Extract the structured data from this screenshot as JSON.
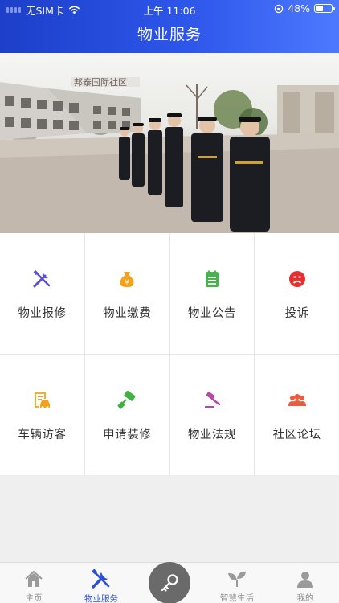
{
  "status_bar": {
    "carrier": "无SIM卡",
    "time": "上午 11:06",
    "battery_text": "48%",
    "battery_level": 0.48
  },
  "header": {
    "title": "物业服务"
  },
  "banner": {
    "sign_text": "邦泰国际社区"
  },
  "services": [
    {
      "label": "物业报修",
      "icon": "repair-tools-icon",
      "color": "#5b4fd6"
    },
    {
      "label": "物业缴费",
      "icon": "money-bag-icon",
      "color": "#f2a21d"
    },
    {
      "label": "物业公告",
      "icon": "notice-board-icon",
      "color": "#4caf50"
    },
    {
      "label": "投诉",
      "icon": "sad-face-icon",
      "color": "#e52f2f"
    },
    {
      "label": "车辆访客",
      "icon": "vehicle-visitor-icon",
      "color": "#f3a21a"
    },
    {
      "label": "申请装修",
      "icon": "paint-roller-icon",
      "color": "#43b043"
    },
    {
      "label": "物业法规",
      "icon": "gavel-icon",
      "color": "#b348a8"
    },
    {
      "label": "社区论坛",
      "icon": "community-people-icon",
      "color": "#ef5a3d"
    }
  ],
  "tabbar": {
    "items": [
      {
        "label": "主页",
        "icon": "home-icon"
      },
      {
        "label": "物业服务",
        "icon": "property-service-icon",
        "active": true
      },
      {
        "label": "",
        "icon": "key-icon"
      },
      {
        "label": "智慧生活",
        "icon": "sprout-icon"
      },
      {
        "label": "我的",
        "icon": "user-icon"
      }
    ]
  },
  "colors": {
    "accent": "#2b4fd6",
    "header_start": "#1d3fc9",
    "header_end": "#4d79ff"
  }
}
